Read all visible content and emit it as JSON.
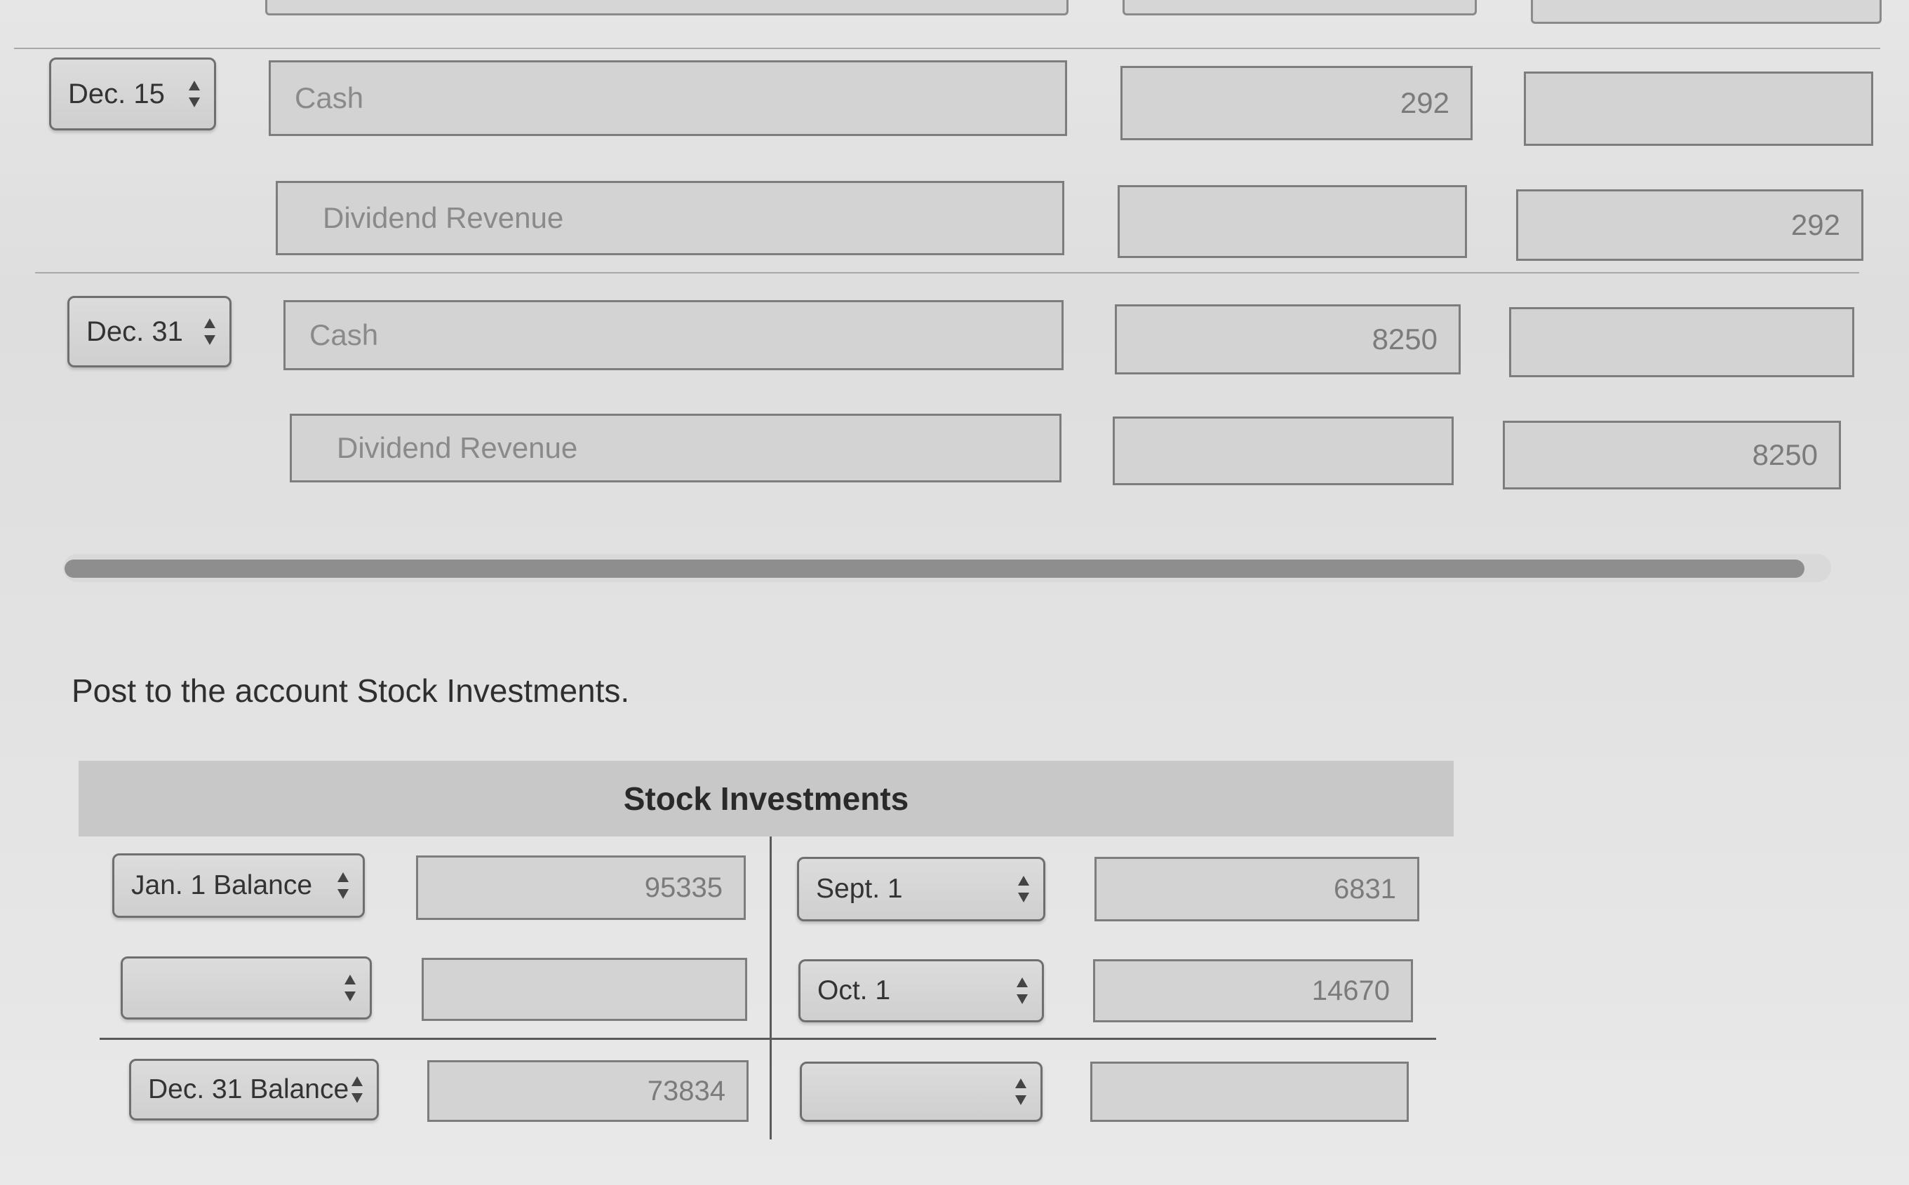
{
  "journal": {
    "entries": [
      {
        "date": "Dec. 15",
        "lines": [
          {
            "account": "Cash",
            "debit": "292",
            "credit": ""
          },
          {
            "account": "Dividend Revenue",
            "debit": "",
            "credit": "292"
          }
        ]
      },
      {
        "date": "Dec. 31",
        "lines": [
          {
            "account": "Cash",
            "debit": "8250",
            "credit": ""
          },
          {
            "account": "Dividend Revenue",
            "debit": "",
            "credit": "8250"
          }
        ]
      }
    ]
  },
  "instruction": "Post to the account Stock Investments.",
  "taccount": {
    "title": "Stock Investments",
    "debit_rows": [
      {
        "label": "Jan. 1 Balance",
        "amount": "95335"
      },
      {
        "label": "",
        "amount": ""
      }
    ],
    "credit_rows": [
      {
        "label": "Sept. 1",
        "amount": "6831"
      },
      {
        "label": "Oct. 1",
        "amount": "14670"
      }
    ],
    "balance_row": {
      "debit_label": "Dec. 31 Balance",
      "debit_amount": "73834",
      "credit_label": "",
      "credit_amount": ""
    }
  }
}
